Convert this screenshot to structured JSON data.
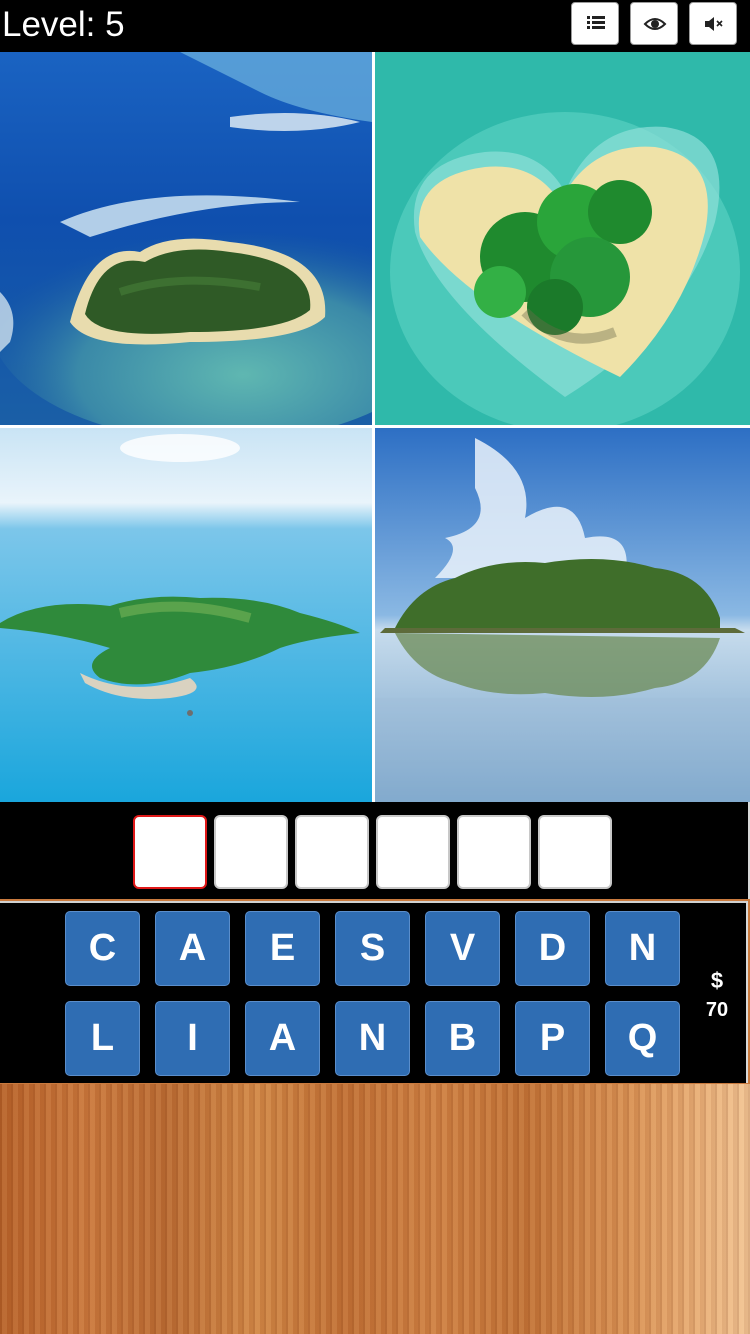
{
  "header": {
    "level_label": "Level: 5",
    "buttons": [
      {
        "name": "levels-button",
        "icon": "list-icon"
      },
      {
        "name": "reveal-button",
        "icon": "eye-icon"
      },
      {
        "name": "mute-button",
        "icon": "speaker-muted-icon"
      }
    ]
  },
  "puzzle": {
    "images": [
      {
        "subject": "heart-shaped island in reef lagoon"
      },
      {
        "subject": "heart-shaped sandy island with palms"
      },
      {
        "subject": "green hilly island in blue sea"
      },
      {
        "subject": "tree-covered island reflected in lake"
      }
    ],
    "answer_length": 6,
    "answer_slots": [
      "",
      "",
      "",
      "",
      "",
      ""
    ],
    "active_slot": 0
  },
  "keyboard": {
    "row1": [
      "C",
      "A",
      "E",
      "S",
      "V",
      "D",
      "N"
    ],
    "row2": [
      "L",
      "I",
      "A",
      "N",
      "B",
      "P",
      "Q"
    ]
  },
  "coins": {
    "symbol": "$",
    "amount": "70"
  },
  "colors": {
    "key_bg": "#2f6db3",
    "active_slot_border": "#e01818",
    "bar_bg": "#000000"
  }
}
